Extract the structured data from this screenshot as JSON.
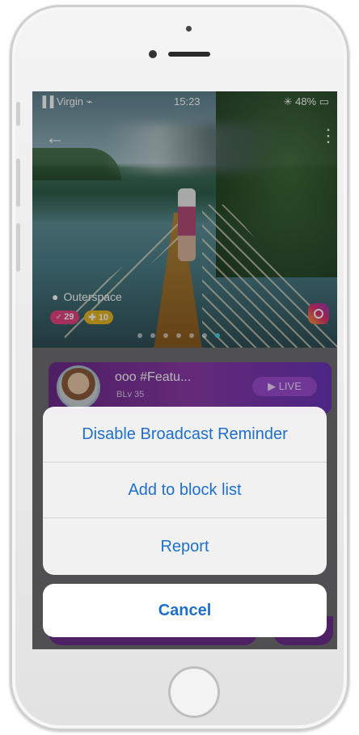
{
  "status_bar": {
    "carrier": "▐▐ Virgin ⌁",
    "time": "15:23",
    "battery": "✳ 48% ▭"
  },
  "photo": {
    "location": "Outerspace",
    "badges": [
      {
        "text": "♂ 29"
      },
      {
        "text": "✚ 10"
      }
    ],
    "page_count": 7,
    "active_page": 6
  },
  "card": {
    "title": "ooo #Featu...",
    "subtitle": "BLv 35",
    "live_label": "▶ LIVE"
  },
  "action_sheet": {
    "items": [
      {
        "label": "Disable Broadcast Reminder"
      },
      {
        "label": "Add to block list"
      },
      {
        "label": "Report"
      }
    ],
    "cancel_label": "Cancel"
  },
  "colors": {
    "action_blue": "#1f6fcc",
    "live_purple": "#8a3aa7",
    "badge_pink": "#e2457c",
    "badge_gold": "#e7b624",
    "page_dot_active": "#44d4e6"
  },
  "icons": [
    "back-arrow-icon",
    "more-options-icon",
    "location-pin-icon",
    "instagram-icon"
  ]
}
